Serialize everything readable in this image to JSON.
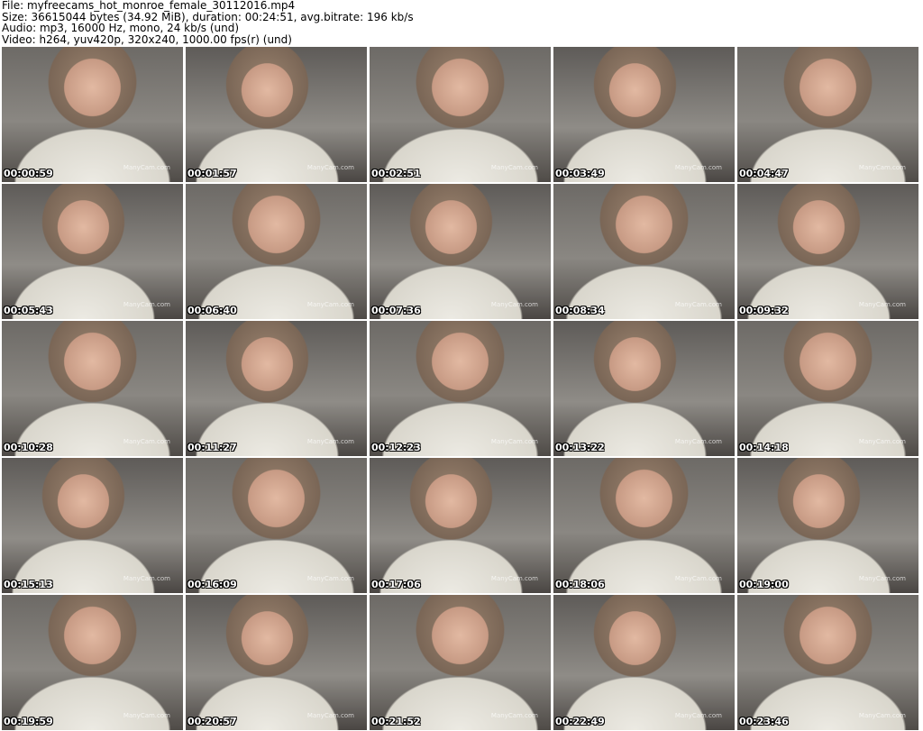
{
  "header": {
    "file": "File: myfreecams_hot_monroe_female_30112016.mp4",
    "size": "Size: 36615044 bytes (34.92 MiB), duration: 00:24:51, avg.bitrate: 196 kb/s",
    "audio": "Audio: mp3, 16000 Hz, mono, 24 kb/s (und)",
    "video": "Video: h264, yuv420p, 320x240, 1000.00 fps(r) (und)"
  },
  "watermark": "ManyCam.com",
  "thumbnails": [
    "00:00:59",
    "00:01:57",
    "00:02:51",
    "00:03:49",
    "00:04:47",
    "00:05:43",
    "00:06:40",
    "00:07:36",
    "00:08:34",
    "00:09:32",
    "00:10:28",
    "00:11:27",
    "00:12:23",
    "00:13:22",
    "00:14:18",
    "00:15:13",
    "00:16:09",
    "00:17:06",
    "00:18:06",
    "00:19:00",
    "00:19:59",
    "00:20:57",
    "00:21:52",
    "00:22:49",
    "00:23:46"
  ]
}
